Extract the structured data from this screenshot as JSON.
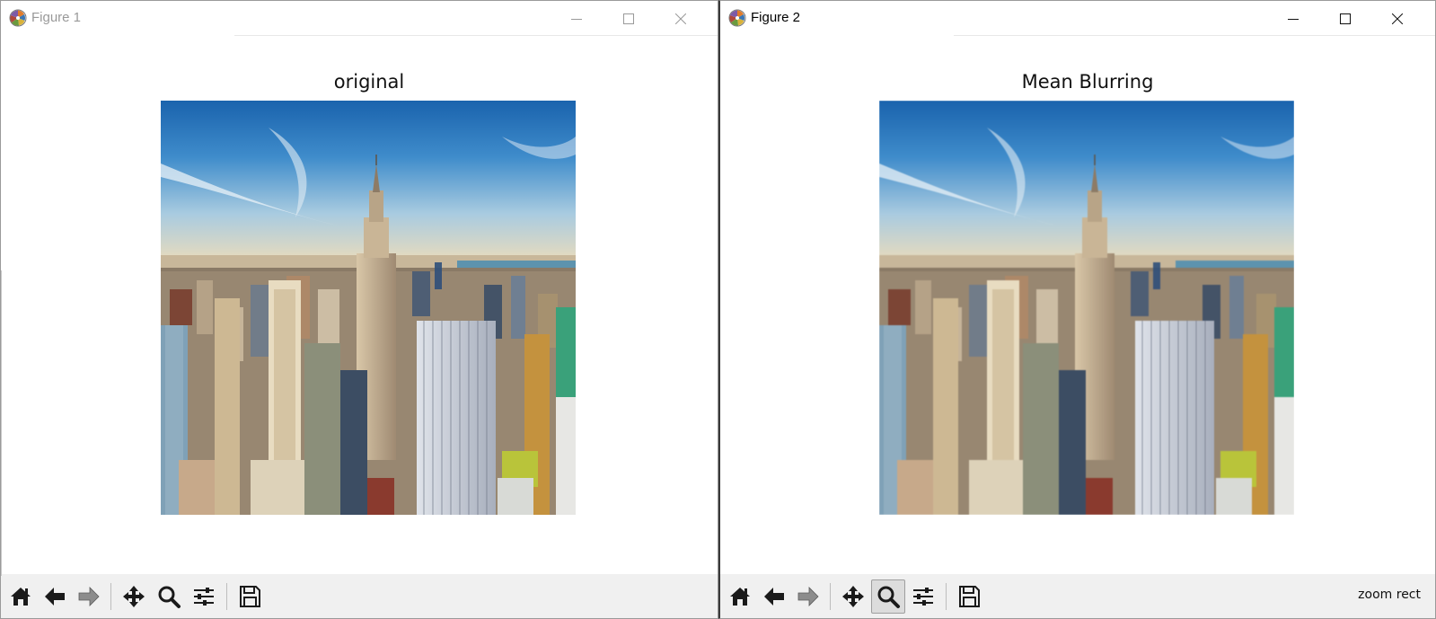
{
  "windows": [
    {
      "title": "Figure 1",
      "active": false,
      "axes_title": "original",
      "status_text": "",
      "active_tool": "none"
    },
    {
      "title": "Figure 2",
      "active": true,
      "axes_title": "Mean Blurring",
      "status_text": "zoom rect",
      "active_tool": "zoom"
    }
  ],
  "window_controls": [
    "minimize-icon",
    "maximize-icon",
    "close-icon"
  ],
  "toolbar_buttons": [
    "home-icon",
    "back-arrow-icon",
    "forward-arrow-icon",
    "pan-move-icon",
    "zoom-magnifier-icon",
    "configure-subplots-icon",
    "save-floppy-icon"
  ],
  "image_subject": "Manhattan skyline photo with Empire State Building under a blue sky",
  "colors": {
    "titlebar_bg": "#ffffff",
    "toolbar_bg": "#f0f0f0",
    "sky_top": "#1e6fb5",
    "sky_horizon": "#e8d9b6",
    "water": "#5d93ae"
  }
}
